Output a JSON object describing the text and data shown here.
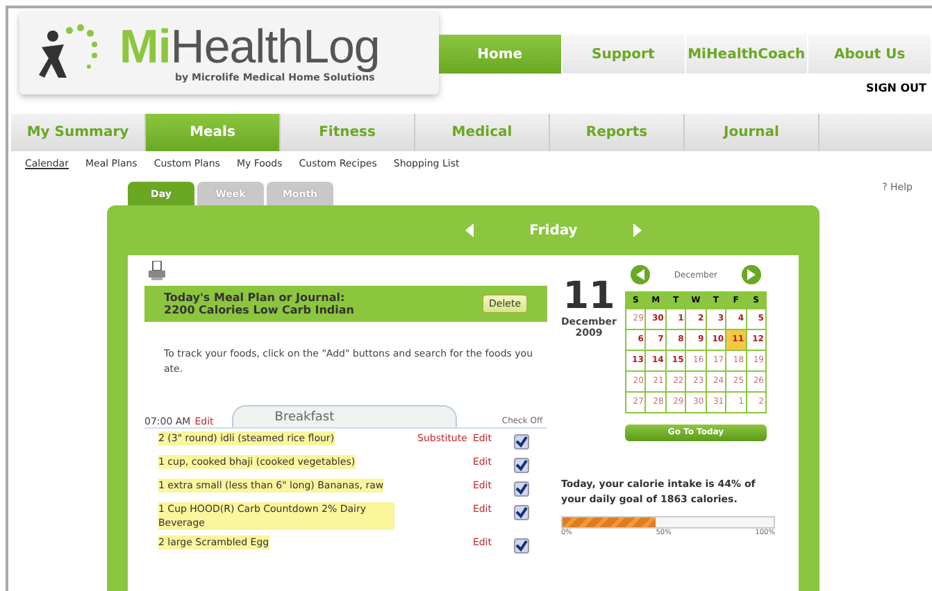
{
  "logo": {
    "name_part1": "Mi",
    "name_part2": "HealthLog",
    "tagline": "by Microlife Medical Home Solutions"
  },
  "top_nav": [
    {
      "label": "Home",
      "selected": true
    },
    {
      "label": "Support",
      "selected": false
    },
    {
      "label": "MiHealthCoach",
      "selected": false
    },
    {
      "label": "About Us",
      "selected": false
    }
  ],
  "sign_out": "SIGN OUT",
  "main_tabs": [
    {
      "label": "My Summary",
      "selected": false
    },
    {
      "label": "Meals",
      "selected": true
    },
    {
      "label": "Fitness",
      "selected": false
    },
    {
      "label": "Medical",
      "selected": false
    },
    {
      "label": "Reports",
      "selected": false
    },
    {
      "label": "Journal",
      "selected": false
    }
  ],
  "sub_nav": [
    {
      "label": "Calendar",
      "selected": true
    },
    {
      "label": "Meal Plans",
      "selected": false
    },
    {
      "label": "Custom Plans",
      "selected": false
    },
    {
      "label": "My Foods",
      "selected": false
    },
    {
      "label": "Custom Recipes",
      "selected": false
    },
    {
      "label": "Shopping List",
      "selected": false
    }
  ],
  "help": "? Help",
  "view_tabs": [
    {
      "label": "Day",
      "selected": true
    },
    {
      "label": "Week",
      "selected": false
    },
    {
      "label": "Month",
      "selected": false
    }
  ],
  "day_title": "Friday",
  "meal_plan": {
    "title": "Today's Meal Plan or Journal:",
    "plan": "2200 Calories Low Carb Indian",
    "delete": "Delete"
  },
  "instructions": "To track your foods, click on the \"Add\" buttons and search for the foods you ate.",
  "meal": {
    "time": "07:00 AM",
    "edit": "Edit",
    "name": "Breakfast",
    "check_header": "Check Off",
    "items": [
      {
        "food": "2 (3\" round) idli (steamed rice flour)",
        "substitute": "Substitute",
        "edit": "Edit",
        "checked": true
      },
      {
        "food": "1 cup, cooked bhaji (cooked vegetables)",
        "edit": "Edit",
        "checked": true
      },
      {
        "food": "1 extra small (less than 6\" long) Bananas, raw",
        "edit": "Edit",
        "checked": true
      },
      {
        "food": "1 Cup HOOD(R) Carb Countdown 2% Dairy Beverage",
        "edit": "Edit",
        "checked": true
      },
      {
        "food": "2 large Scrambled Egg",
        "edit": "Edit",
        "checked": true
      }
    ]
  },
  "date": {
    "day": "11",
    "month": "December",
    "year": "2009"
  },
  "calendar": {
    "month": "December",
    "weekdays": [
      "S",
      "M",
      "T",
      "W",
      "T",
      "F",
      "S"
    ],
    "days": [
      {
        "label": "29",
        "active": false,
        "selected": false
      },
      {
        "label": "30",
        "active": true,
        "selected": false
      },
      {
        "label": "1",
        "active": true,
        "selected": false
      },
      {
        "label": "2",
        "active": true,
        "selected": false
      },
      {
        "label": "3",
        "active": true,
        "selected": false
      },
      {
        "label": "4",
        "active": true,
        "selected": false
      },
      {
        "label": "5",
        "active": true,
        "selected": false
      },
      {
        "label": "6",
        "active": true,
        "selected": false
      },
      {
        "label": "7",
        "active": true,
        "selected": false
      },
      {
        "label": "8",
        "active": true,
        "selected": false
      },
      {
        "label": "9",
        "active": true,
        "selected": false
      },
      {
        "label": "10",
        "active": true,
        "selected": false
      },
      {
        "label": "11",
        "active": true,
        "selected": true
      },
      {
        "label": "12",
        "active": true,
        "selected": false
      },
      {
        "label": "13",
        "active": true,
        "selected": false
      },
      {
        "label": "14",
        "active": true,
        "selected": false
      },
      {
        "label": "15",
        "active": true,
        "selected": false
      },
      {
        "label": "16",
        "active": false,
        "selected": false
      },
      {
        "label": "17",
        "active": false,
        "selected": false
      },
      {
        "label": "18",
        "active": false,
        "selected": false
      },
      {
        "label": "19",
        "active": false,
        "selected": false
      },
      {
        "label": "20",
        "active": false,
        "selected": false
      },
      {
        "label": "21",
        "active": false,
        "selected": false
      },
      {
        "label": "22",
        "active": false,
        "selected": false
      },
      {
        "label": "23",
        "active": false,
        "selected": false
      },
      {
        "label": "24",
        "active": false,
        "selected": false
      },
      {
        "label": "25",
        "active": false,
        "selected": false
      },
      {
        "label": "26",
        "active": false,
        "selected": false
      },
      {
        "label": "27",
        "active": false,
        "selected": false
      },
      {
        "label": "28",
        "active": false,
        "selected": false
      },
      {
        "label": "29",
        "active": false,
        "selected": false
      },
      {
        "label": "30",
        "active": false,
        "selected": false
      },
      {
        "label": "31",
        "active": false,
        "selected": false
      },
      {
        "label": "1",
        "active": false,
        "selected": false
      },
      {
        "label": "2",
        "active": false,
        "selected": false
      }
    ],
    "today_button": "Go To Today"
  },
  "calorie": {
    "text": "Today, your calorie intake is 44% of your daily goal of 1863 calories.",
    "level": 0.44,
    "ticks": [
      "0%",
      "50%",
      "100%"
    ]
  }
}
